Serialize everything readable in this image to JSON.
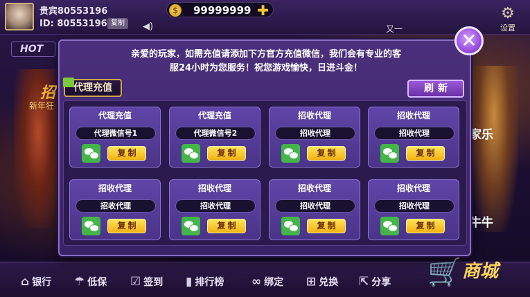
{
  "header": {
    "nickname": "贵宾80553196",
    "id_label": "ID: 80553196",
    "copy_label": "复制",
    "coins": "99999999",
    "marquee": "又一",
    "settings_label": "设置"
  },
  "lobby": {
    "hot_tab": "HOT",
    "left_banner": "招",
    "left_banner_sub": "新年狂",
    "right_label_1": "家乐",
    "right_label_2": "牛牛"
  },
  "bottom_nav": [
    {
      "icon": "bank-icon",
      "glyph": "⌂",
      "label": "银行"
    },
    {
      "icon": "umbrella-icon",
      "glyph": "☂",
      "label": "低保"
    },
    {
      "icon": "calendar-icon",
      "glyph": "☑",
      "label": "签到"
    },
    {
      "icon": "ranking-icon",
      "glyph": "▮",
      "label": "排行榜"
    },
    {
      "icon": "link-icon",
      "glyph": "∞",
      "label": "绑定"
    },
    {
      "icon": "gift-icon",
      "glyph": "⊞",
      "label": "兑换"
    },
    {
      "icon": "share-icon",
      "glyph": "⇱",
      "label": "分享"
    }
  ],
  "shop_label": "商城",
  "modal": {
    "notice_line1": "亲爱的玩家，如需充值请添加下方官方充值微信，我们会有专业的客",
    "notice_line2": "服24小时为您服务！祝您游戏愉快，日进斗金！",
    "tag_label": "代理充值",
    "refresh_label": "刷新",
    "cards": [
      {
        "title": "代理充值",
        "wx": "代理微信号1",
        "copy": "复制"
      },
      {
        "title": "代理充值",
        "wx": "代理微信号2",
        "copy": "复制"
      },
      {
        "title": "招收代理",
        "wx": "招收代理",
        "copy": "复制"
      },
      {
        "title": "招收代理",
        "wx": "招收代理",
        "copy": "复制"
      },
      {
        "title": "招收代理",
        "wx": "招收代理",
        "copy": "复制"
      },
      {
        "title": "招收代理",
        "wx": "招收代理",
        "copy": "复制"
      },
      {
        "title": "招收代理",
        "wx": "招收代理",
        "copy": "复制"
      },
      {
        "title": "招收代理",
        "wx": "招收代理",
        "copy": "复制"
      }
    ]
  },
  "colors": {
    "modal_bg": "#4b2f7c",
    "card_bg": "#5f45a8",
    "copy_button": "#f2b213",
    "wechat_green": "#44b549"
  }
}
